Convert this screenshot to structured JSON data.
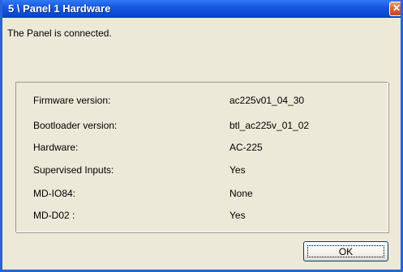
{
  "window": {
    "title": "5 \\ Panel 1 Hardware",
    "close_symbol": "✕"
  },
  "status": {
    "message": "The Panel is connected."
  },
  "info": {
    "rows": [
      {
        "label": "Firmware version:",
        "value": "ac225v01_04_30"
      },
      {
        "label": "Bootloader version:",
        "value": "btl_ac225v_01_02"
      },
      {
        "label": "Hardware:",
        "value": "AC-225"
      },
      {
        "label": "Supervised Inputs:",
        "value": "Yes"
      },
      {
        "label": "MD-IO84:",
        "value": "None"
      },
      {
        "label": "MD-D02 :",
        "value": "Yes"
      }
    ]
  },
  "buttons": {
    "ok_label": "OK"
  },
  "colors": {
    "titlebar": "#0a48d2",
    "window_face": "#ece9d8",
    "close_button": "#d9633a"
  }
}
